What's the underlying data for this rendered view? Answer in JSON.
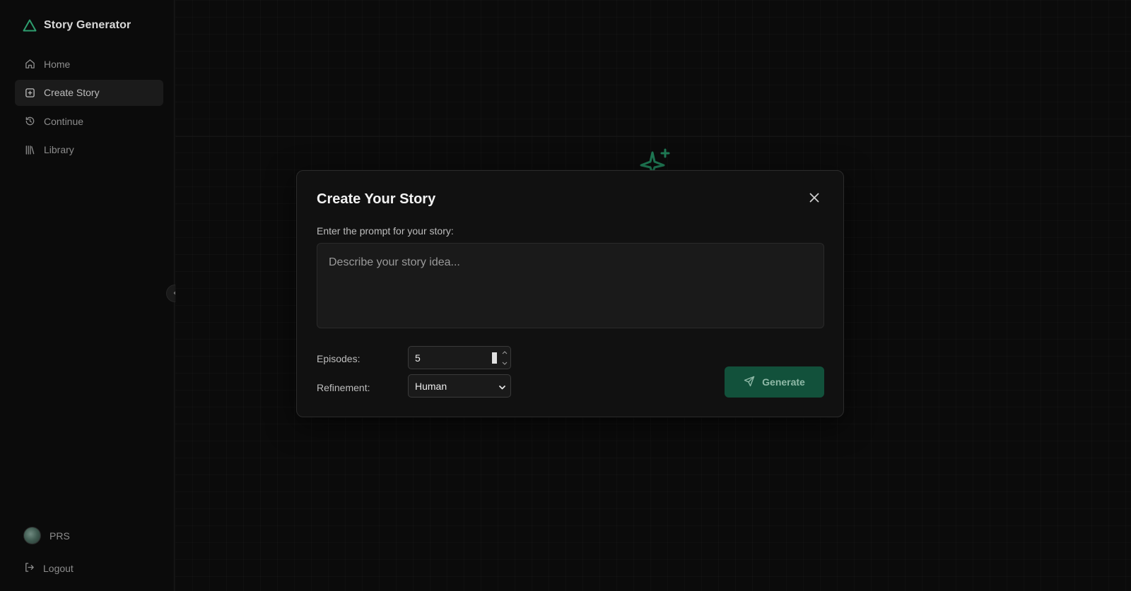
{
  "app": {
    "title": "Story Generator"
  },
  "sidebar": {
    "items": [
      {
        "label": "Home",
        "icon": "home-icon"
      },
      {
        "label": "Create Story",
        "icon": "plus-square-icon",
        "active": true
      },
      {
        "label": "Continue",
        "icon": "history-icon"
      },
      {
        "label": "Library",
        "icon": "library-icon"
      }
    ],
    "user": {
      "name": "PRS"
    },
    "logout_label": "Logout"
  },
  "modal": {
    "title": "Create Your Story",
    "prompt_label": "Enter the prompt for your story:",
    "prompt_placeholder": "Describe your story idea...",
    "prompt_value": "",
    "episodes_label": "Episodes:",
    "episodes_value": "5",
    "refinement_label": "Refinement:",
    "refinement_value": "Human",
    "generate_label": "Generate"
  },
  "colors": {
    "accent": "#12513b",
    "brand": "#2e9e6f",
    "background": "#0b0b0b",
    "modal_bg": "#111111"
  }
}
